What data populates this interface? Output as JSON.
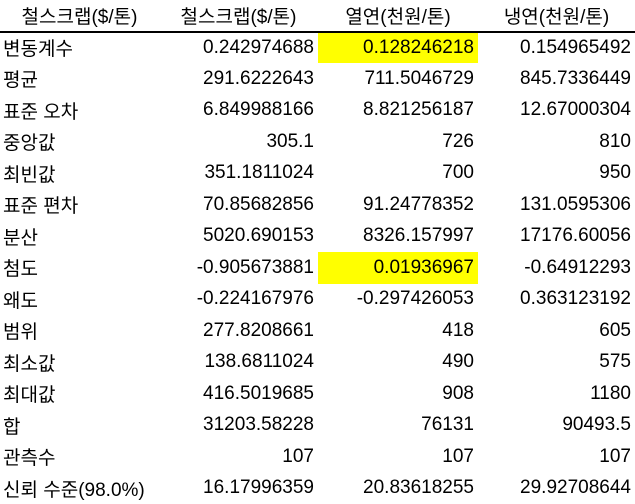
{
  "colors": {
    "highlight": "#ffff00"
  },
  "header": [
    "철스크랩($/톤)",
    "철스크랩($/톤)",
    "열연(천원/톤)",
    "냉연(천원/톤)"
  ],
  "rows": [
    {
      "label": "변동계수",
      "values": [
        "0.242974688",
        "0.128246218",
        "0.154965492"
      ],
      "highlight": [
        false,
        true,
        false
      ]
    },
    {
      "label": "평균",
      "values": [
        "291.6222643",
        "711.5046729",
        "845.7336449"
      ],
      "highlight": [
        false,
        false,
        false
      ]
    },
    {
      "label": "표준 오차",
      "values": [
        "6.849988166",
        "8.821256187",
        "12.67000304"
      ],
      "highlight": [
        false,
        false,
        false
      ]
    },
    {
      "label": "중앙값",
      "values": [
        "305.1",
        "726",
        "810"
      ],
      "highlight": [
        false,
        false,
        false
      ]
    },
    {
      "label": "최빈값",
      "values": [
        "351.1811024",
        "700",
        "950"
      ],
      "highlight": [
        false,
        false,
        false
      ]
    },
    {
      "label": "표준 편차",
      "values": [
        "70.85682856",
        "91.24778352",
        "131.0595306"
      ],
      "highlight": [
        false,
        false,
        false
      ]
    },
    {
      "label": "분산",
      "values": [
        "5020.690153",
        "8326.157997",
        "17176.60056"
      ],
      "highlight": [
        false,
        false,
        false
      ]
    },
    {
      "label": "첨도",
      "values": [
        "-0.905673881",
        "0.01936967",
        "-0.64912293"
      ],
      "highlight": [
        false,
        true,
        false
      ]
    },
    {
      "label": "왜도",
      "values": [
        "-0.224167976",
        "-0.297426053",
        "0.363123192"
      ],
      "highlight": [
        false,
        false,
        false
      ]
    },
    {
      "label": "범위",
      "values": [
        "277.8208661",
        "418",
        "605"
      ],
      "highlight": [
        false,
        false,
        false
      ]
    },
    {
      "label": "최소값",
      "values": [
        "138.6811024",
        "490",
        "575"
      ],
      "highlight": [
        false,
        false,
        false
      ]
    },
    {
      "label": "최대값",
      "values": [
        "416.5019685",
        "908",
        "1180"
      ],
      "highlight": [
        false,
        false,
        false
      ]
    },
    {
      "label": "합",
      "values": [
        "31203.58228",
        "76131",
        "90493.5"
      ],
      "highlight": [
        false,
        false,
        false
      ]
    },
    {
      "label": "관측수",
      "values": [
        "107",
        "107",
        "107"
      ],
      "highlight": [
        false,
        false,
        false
      ]
    },
    {
      "label": "신뢰 수준(98.0%)",
      "values": [
        "16.17996359",
        "20.83618255",
        "29.92708644"
      ],
      "highlight": [
        false,
        false,
        false
      ]
    }
  ]
}
